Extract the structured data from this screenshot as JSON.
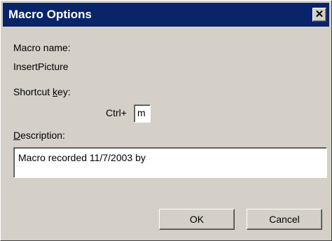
{
  "window": {
    "title": "Macro Options",
    "close_glyph": "✕"
  },
  "macro_name": {
    "label": "Macro name:",
    "value": "InsertPicture"
  },
  "shortcut": {
    "label_pre": "Shortcut ",
    "label_accel": "k",
    "label_post": "ey:",
    "prefix": "Ctrl+",
    "value": "m"
  },
  "description": {
    "label_accel": "D",
    "label_post": "escription:",
    "value": "Macro recorded 11/7/2003 by"
  },
  "buttons": {
    "ok": "OK",
    "cancel": "Cancel"
  },
  "colors": {
    "titlebar": "#0a246a",
    "face": "#d4d0c8"
  }
}
